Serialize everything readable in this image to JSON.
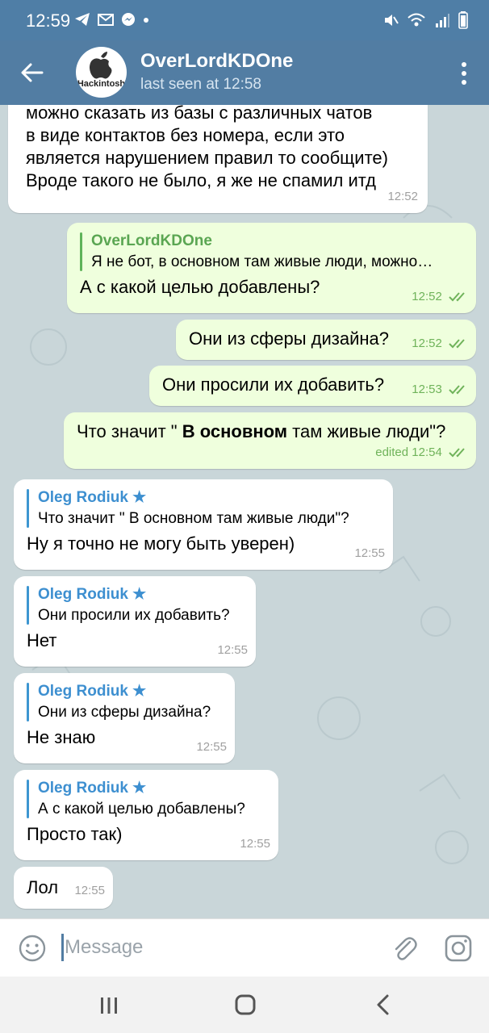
{
  "status_bar": {
    "time": "12:59",
    "left_icons": [
      "telegram-icon",
      "mail-icon",
      "messenger-icon",
      "dot-icon"
    ],
    "right_icons": [
      "mute-icon",
      "wifi-icon",
      "signal-icon",
      "battery-icon"
    ]
  },
  "header": {
    "title": "OverLordKDOne",
    "subtitle": "last seen at 12:58",
    "avatar_text": "Hackintosh"
  },
  "messages": [
    {
      "dir": "in",
      "text": "можно сказать из базы с различных чатов\nв виде контактов без номера, если это\nявляется нарушением правил то сообщите)\nВроде такого не было, я же не спамил итд",
      "time": "12:52"
    },
    {
      "dir": "out",
      "reply_name": "OverLordKDOne",
      "reply_text": "Я не бот, в основном там живые люди, можно…",
      "text": "А с какой целью добавлены?",
      "time": "12:52",
      "read": true
    },
    {
      "dir": "out",
      "text": "Они из сферы дизайна?",
      "time": "12:52",
      "read": true
    },
    {
      "dir": "out",
      "text": "Они просили их добавить?",
      "time": "12:53",
      "read": true
    },
    {
      "dir": "out",
      "text_before": "Что значит \" ",
      "text_bold": "В основном",
      "text_after": " там живые люди\"?",
      "time": "edited 12:54",
      "read": true
    },
    {
      "dir": "in",
      "reply_name": "Oleg Rodiuk ★",
      "reply_text": "Что значит \" В основном там живые люди\"?",
      "text": "Ну я точно не могу быть уверен)",
      "time": "12:55"
    },
    {
      "dir": "in",
      "reply_name": "Oleg Rodiuk ★",
      "reply_text": "Они просили их добавить?",
      "text": "Нет",
      "time": "12:55"
    },
    {
      "dir": "in",
      "reply_name": "Oleg Rodiuk ★",
      "reply_text": "Они из сферы дизайна?",
      "text": "Не знаю",
      "time": "12:55"
    },
    {
      "dir": "in",
      "reply_name": "Oleg Rodiuk ★",
      "reply_text": "А с какой целью добавлены?",
      "text": "Просто так)",
      "time": "12:55"
    },
    {
      "dir": "in",
      "text": "Лол",
      "time": "12:55"
    }
  ],
  "input": {
    "placeholder": "Message"
  },
  "colors": {
    "header": "#527da3",
    "status_bar": "#4f7ea6",
    "chat_bg": "#c9d6d9",
    "bubble_in": "#ffffff",
    "bubble_out": "#efffdd",
    "reply_name_in": "#3d8fd0",
    "reply_name_out": "#5aa652",
    "checkmarks": "#6fb35a"
  }
}
